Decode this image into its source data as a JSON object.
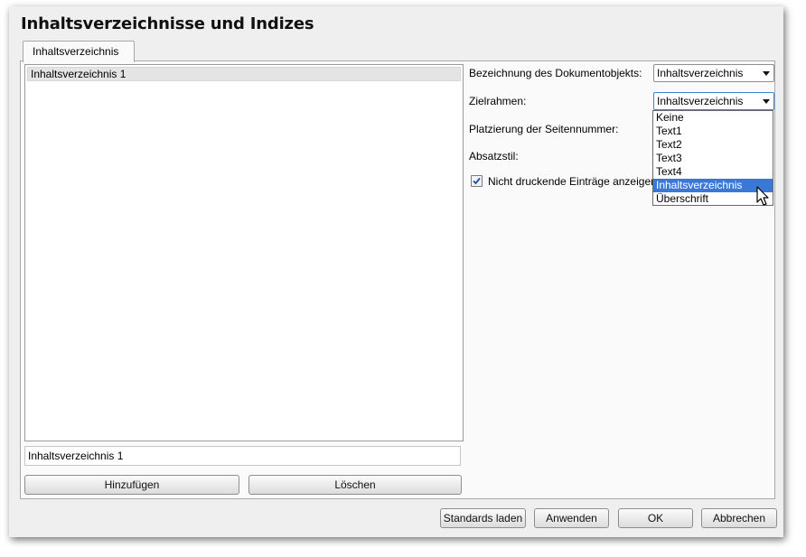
{
  "dialog": {
    "title": "Inhaltsverzeichnisse und Indizes",
    "tab_label": "Inhaltsverzeichnis"
  },
  "left": {
    "list_items": [
      "Inhaltsverzeichnis 1"
    ],
    "name_value": "Inhaltsverzeichnis 1",
    "add_label": "Hinzufügen",
    "delete_label": "Löschen"
  },
  "right": {
    "doc_object_label": "Bezeichnung des Dokumentobjekts:",
    "doc_object_value": "Inhaltsverzeichnis",
    "target_frame_label": "Zielrahmen:",
    "target_frame_value": "Inhaltsverzeichnis",
    "page_number_label": "Platzierung der Seitennummer:",
    "paragraph_style_label": "Absatzstil:",
    "nonprinting_label": "Nicht druckende Einträge anzeigen",
    "nonprinting_checked": true,
    "dropdown_options": [
      "Keine",
      "Text1",
      "Text2",
      "Text3",
      "Text4",
      "Inhaltsverzeichnis",
      "Überschrift"
    ],
    "dropdown_selected": "Inhaltsverzeichnis"
  },
  "footer": {
    "load_defaults_label": "Standards laden",
    "apply_label": "Anwenden",
    "ok_label": "OK",
    "cancel_label": "Abbrechen"
  },
  "colors": {
    "selection": "#3a78d8",
    "focus_border": "#3a84cf",
    "dialog_bg": "#efefef"
  }
}
